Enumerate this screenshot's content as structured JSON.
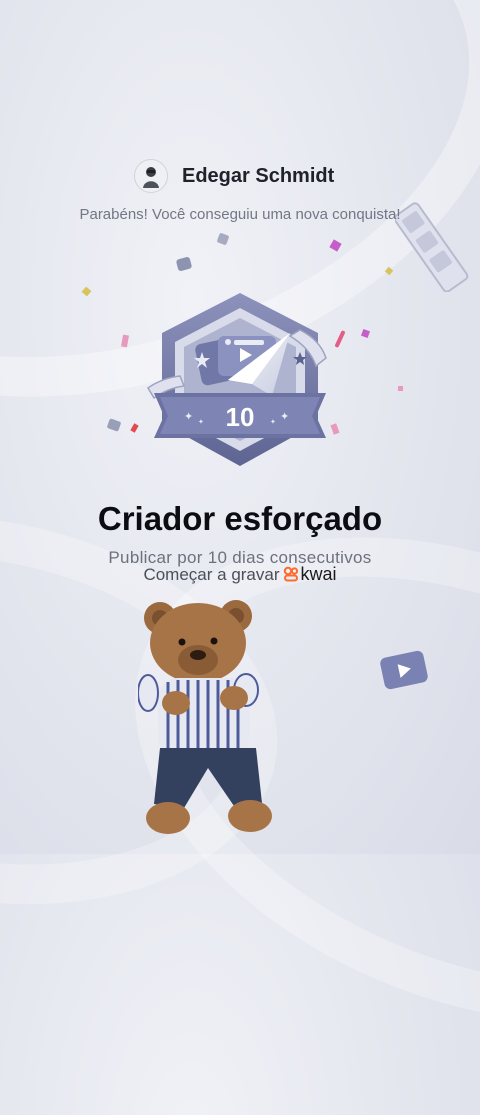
{
  "profile": {
    "user_name": "Edegar Schmidt",
    "message": "Parabéns! Você conseguiu uma nova conquista!"
  },
  "achievement": {
    "badge_number": "10",
    "title": "Criador esforçado",
    "description": "Publicar por 10 dias consecutivos"
  },
  "cta": {
    "text": "Começar a gravar",
    "brand": "kwai"
  },
  "icons": {
    "avatar": "user-avatar-icon",
    "badge": "achievement-badge-icon",
    "brand_logo": "kwai-logo-icon",
    "sticker": "teddy-bear-sticker"
  },
  "colors": {
    "badge_primary": "#7278a6",
    "badge_light": "#e9ebf5",
    "accent_confetti": "#c55ec8",
    "brand": "#ff6a2c"
  }
}
